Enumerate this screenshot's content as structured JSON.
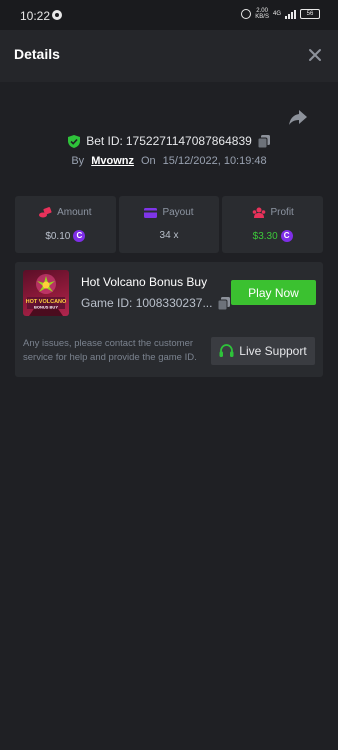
{
  "status_bar": {
    "time": "10:22",
    "net_speed": "2.00",
    "net_unit": "KB/S",
    "net_type": "4G",
    "battery": "56"
  },
  "header": {
    "title": "Details"
  },
  "bet": {
    "id_label": "Bet ID:",
    "id_value": "1752271147087864839",
    "by_label": "By",
    "user": "Mvownz",
    "on_label": "On",
    "datetime": "15/12/2022, 10:19:48"
  },
  "stats": [
    {
      "label": "Amount",
      "value": "$0.10",
      "icon": "coins-icon",
      "color": "#e8315a"
    },
    {
      "label": "Payout",
      "value": "34 x",
      "icon": "card-icon",
      "color": "#7f35e8"
    },
    {
      "label": "Profit",
      "value": "$3.30",
      "icon": "people-icon",
      "color": "#e8315a"
    }
  ],
  "coin_symbol": "C",
  "game": {
    "title": "Hot Volcano Bonus Buy",
    "thumb_text_1": "HOT VOLCANO",
    "thumb_text_2": "BONUS BUY",
    "id_label": "Game ID:",
    "id_value": "1008330237...",
    "play_label": "Play Now",
    "help_text": "Any issues, please contact the customer service for help and provide the game ID.",
    "support_label": "Live Support"
  },
  "colors": {
    "accent_green": "#3bc130",
    "coin_purple": "#7f2ee8",
    "background": "#1f2024",
    "card": "#2a2c30"
  }
}
